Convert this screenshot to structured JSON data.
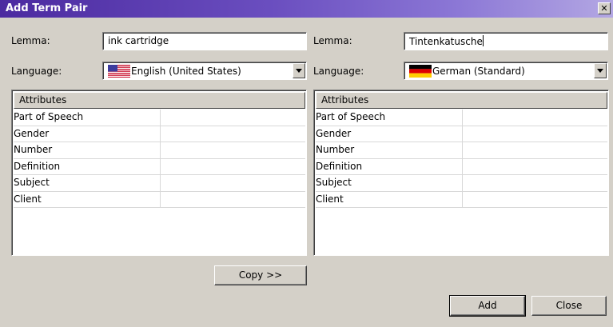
{
  "window": {
    "title": "Add Term Pair"
  },
  "left": {
    "lemma_label": "Lemma:",
    "lemma_value": "ink cartridge",
    "language_label": "Language:",
    "language_value": "English (United States)",
    "flag_icon": "us-flag-icon",
    "attributes_header": "Attributes",
    "attributes": [
      "Part of Speech",
      "Gender",
      "Number",
      "Definition",
      "Subject",
      "Client"
    ]
  },
  "right": {
    "lemma_label": "Lemma:",
    "lemma_value": "Tintenkatusche",
    "language_label": "Language:",
    "language_value": "German (Standard)",
    "flag_icon": "german-flag-icon",
    "attributes_header": "Attributes",
    "attributes": [
      "Part of Speech",
      "Gender",
      "Number",
      "Definition",
      "Subject",
      "Client"
    ]
  },
  "buttons": {
    "copy": "Copy >>",
    "add": "Add",
    "close": "Close"
  },
  "colors": {
    "title_start": "#4b2aa0",
    "title_end": "#b3a7e3",
    "face": "#d4d0c8"
  }
}
